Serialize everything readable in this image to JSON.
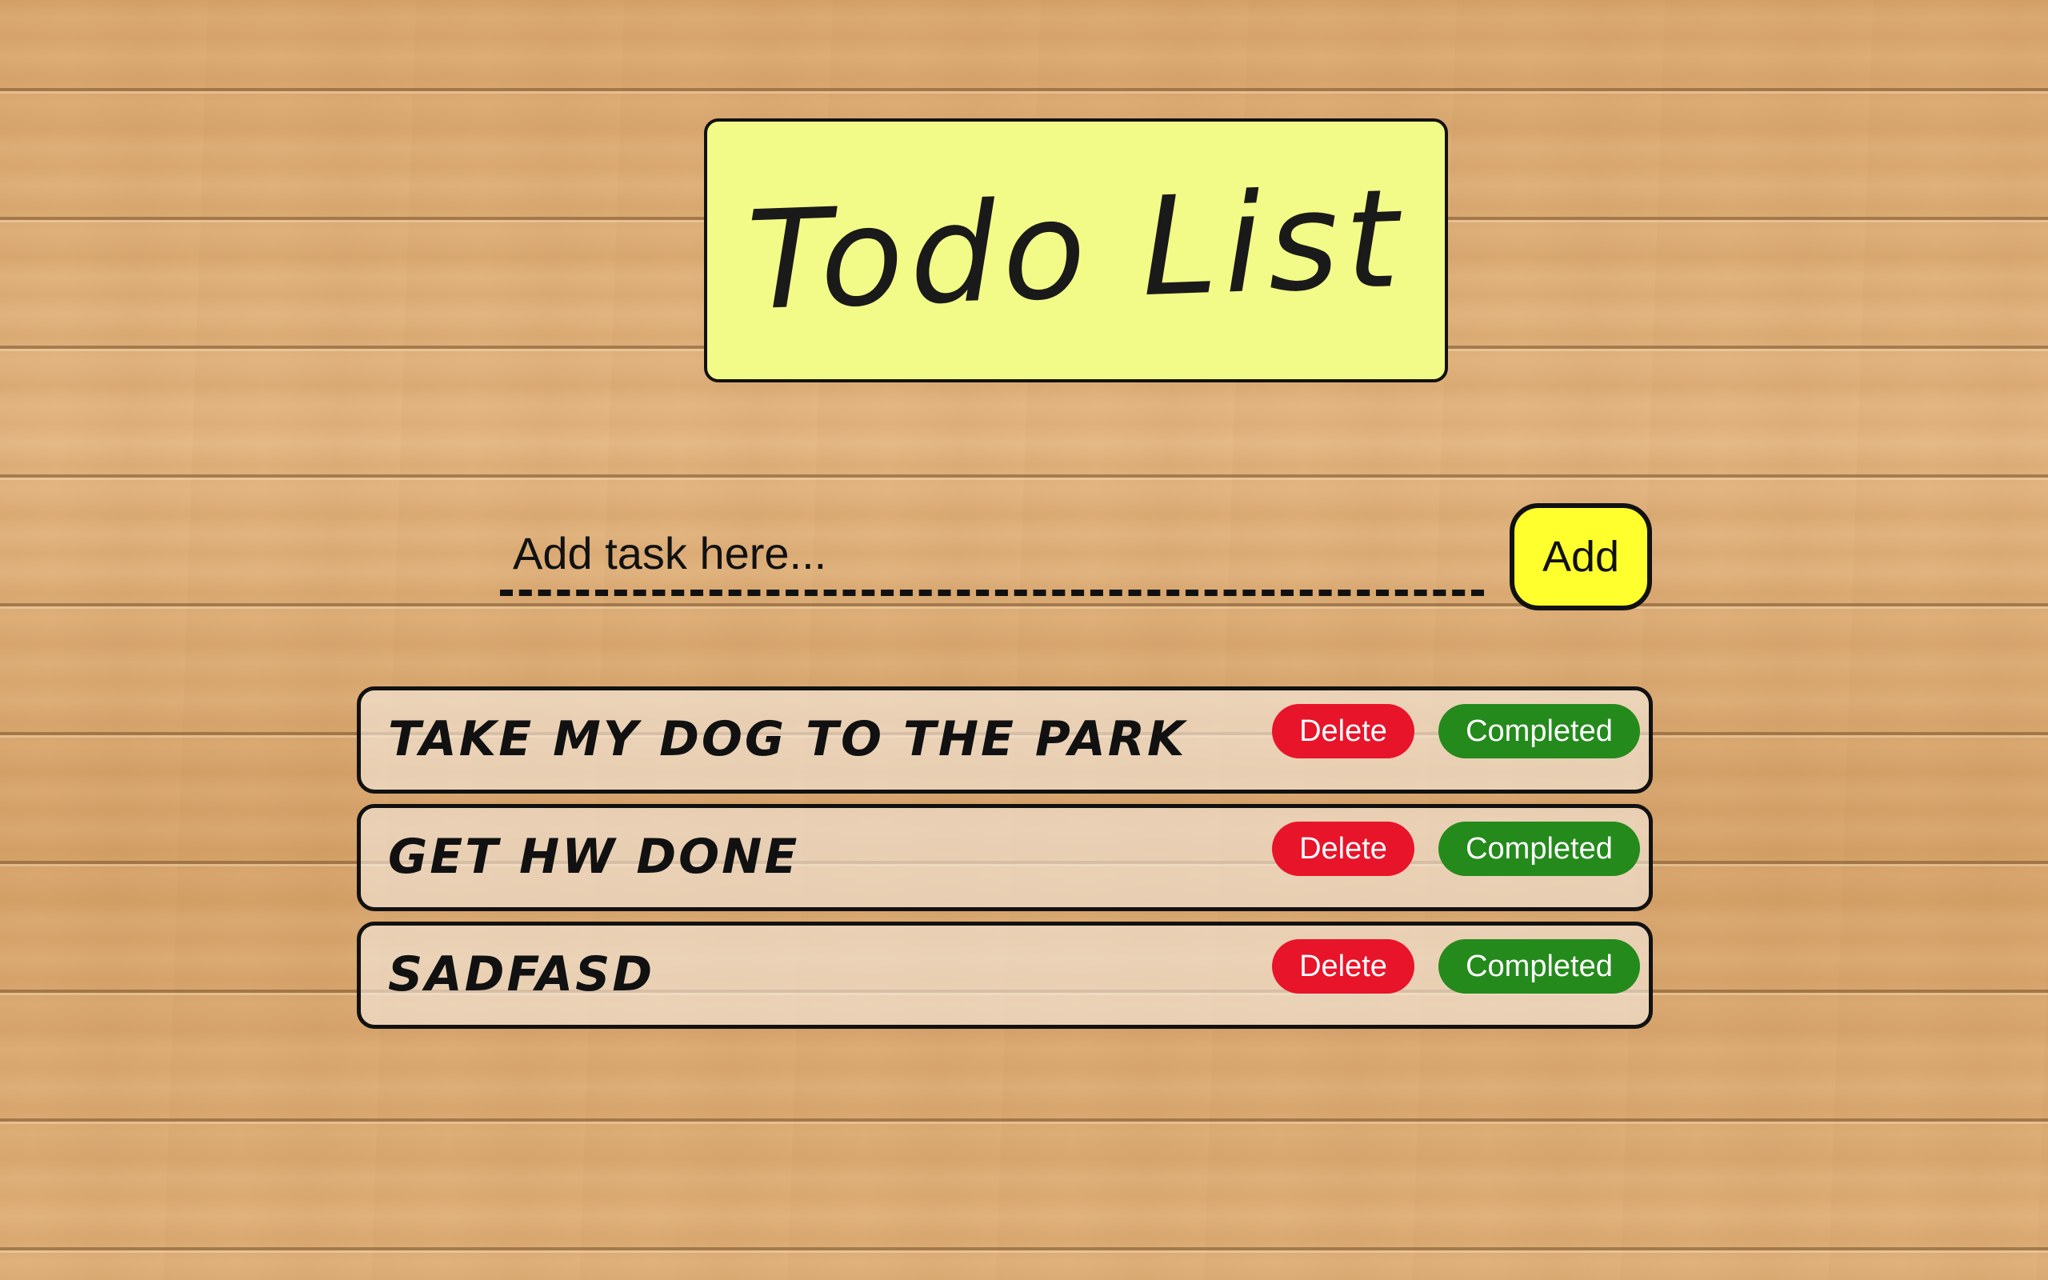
{
  "header": {
    "title": "Todo List"
  },
  "add_form": {
    "input_placeholder": "Add task here...",
    "input_value": "",
    "add_label": "Add"
  },
  "tasks": [
    {
      "label": "Take my dog to the park",
      "delete_label": "Delete",
      "completed_label": "Completed"
    },
    {
      "label": "Get HW done",
      "delete_label": "Delete",
      "completed_label": "Completed"
    },
    {
      "label": "sadfasd",
      "delete_label": "Delete",
      "completed_label": "Completed"
    }
  ],
  "colors": {
    "title_card": "#f2fb87",
    "add_button": "#ffff2e",
    "delete_button": "#e8142a",
    "completed_button": "#248a1c"
  }
}
